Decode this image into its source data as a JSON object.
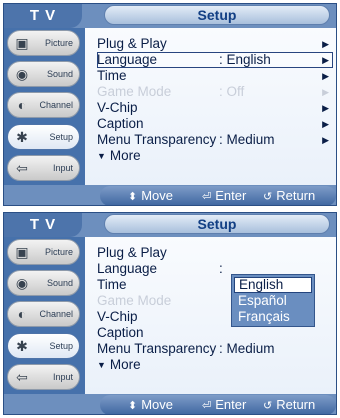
{
  "panels": [
    {
      "tv_label": "T V",
      "title": "Setup",
      "sidebar": [
        {
          "label": "Picture",
          "icon": "picture-icon"
        },
        {
          "label": "Sound",
          "icon": "sound-icon"
        },
        {
          "label": "Channel",
          "icon": "channel-icon"
        },
        {
          "label": "Setup",
          "icon": "setup-icon",
          "active": true
        },
        {
          "label": "Input",
          "icon": "input-icon"
        }
      ],
      "menu": [
        {
          "label": "Plug & Play",
          "value": "",
          "arrow": "▶"
        },
        {
          "label": "Language",
          "value": ": English",
          "arrow": "▶",
          "selected": true
        },
        {
          "label": "Time",
          "value": "",
          "arrow": "▶"
        },
        {
          "label": "Game Mode",
          "value": ": Off",
          "arrow": "▶",
          "disabled": true
        },
        {
          "label": "V-Chip",
          "value": "",
          "arrow": "▶"
        },
        {
          "label": "Caption",
          "value": "",
          "arrow": "▶"
        },
        {
          "label": "Menu Transparency",
          "value": ": Medium",
          "arrow": "▶"
        },
        {
          "label": "More",
          "value": "",
          "arrow": "",
          "more_symbol": "▼"
        }
      ],
      "hints": {
        "move": "Move",
        "enter": "Enter",
        "return": "Return"
      }
    },
    {
      "tv_label": "T V",
      "title": "Setup",
      "sidebar": [
        {
          "label": "Picture",
          "icon": "picture-icon"
        },
        {
          "label": "Sound",
          "icon": "sound-icon"
        },
        {
          "label": "Channel",
          "icon": "channel-icon"
        },
        {
          "label": "Setup",
          "icon": "setup-icon",
          "active": true
        },
        {
          "label": "Input",
          "icon": "input-icon"
        }
      ],
      "menu": [
        {
          "label": "Plug & Play",
          "value": "",
          "arrow": ""
        },
        {
          "label": "Language",
          "value": ":",
          "arrow": ""
        },
        {
          "label": "Time",
          "value": "",
          "arrow": ""
        },
        {
          "label": "Game Mode",
          "value": "",
          "arrow": "",
          "disabled": true
        },
        {
          "label": "V-Chip",
          "value": "",
          "arrow": ""
        },
        {
          "label": "Caption",
          "value": "",
          "arrow": ""
        },
        {
          "label": "Menu Transparency",
          "value": ": Medium",
          "arrow": ""
        },
        {
          "label": "More",
          "value": "",
          "arrow": "",
          "more_symbol": "▼"
        }
      ],
      "language_options": [
        {
          "label": "English",
          "selected": true
        },
        {
          "label": "Español"
        },
        {
          "label": "Français"
        }
      ],
      "hints": {
        "move": "Move",
        "enter": "Enter",
        "return": "Return"
      }
    }
  ],
  "colors": {
    "panel_blue": "#3f6fae",
    "bar_blue": "#6d8fbe",
    "text_dark": "#0a1e47",
    "disabled_text": "#c8ced9"
  }
}
